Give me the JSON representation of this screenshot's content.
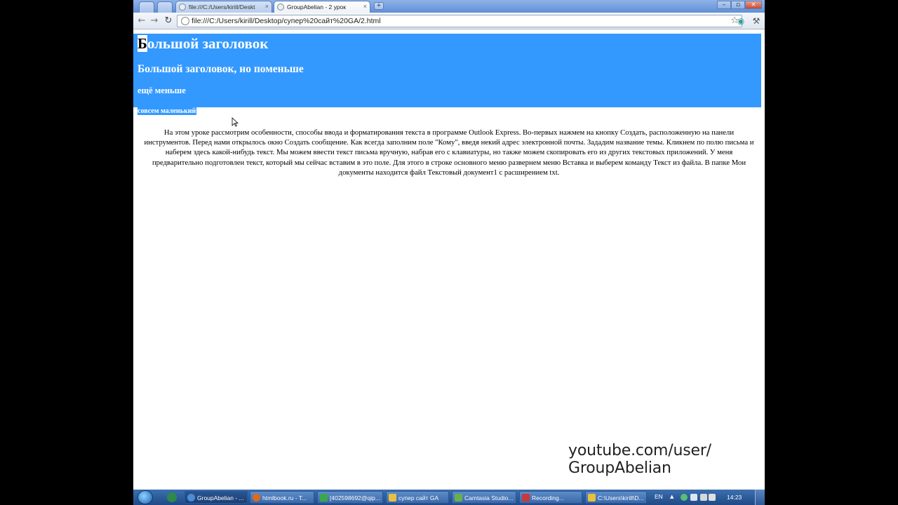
{
  "browser": {
    "tabs": [
      {
        "label": "file:///C:/Users/kirill/Deskt",
        "active": false
      },
      {
        "label": "GroupAbelian - 2 урок",
        "active": true
      }
    ],
    "tab_close": "×",
    "new_tab": "+",
    "window_controls": [
      "–",
      "▫",
      "×"
    ],
    "address": "file:///C:/Users/kirill/Desktop/супер%20сайт%20GA/2.html"
  },
  "page": {
    "h1_first": "Б",
    "h1_rest": "ольшой заголовок",
    "h2": "Большой заголовок, но поменьше",
    "h3": "ещё меньше",
    "h4": "совсем маленький",
    "paragraph": "На этом уроке рассмотрим особенности, способы ввода и форматирования текста в программе Outlook Express. Во-первых нажмем на кнопку Создать, расположенную на панели инструментов. Перед нами открылось окно Создать сообщение. Как всегда заполним поле \"Кому\", введя некий адрес электронной почты. Зададим название темы. Кликнем по полю письма и наберем здесь какой-нибудь текст. Мы можем ввести текст письма вручную, набрав его с клавиатуры, но также можем скопировать его из других текстовых приложений. У меня предварительно подготовлен текст, который мы сейчас вставим в это поле. Для этого в строке основного меню развернем меню Вставка и выберем команду Текст из файла. В папке Мои документы находится файл Текстовый документ1 с расширением txt."
  },
  "watermark": {
    "line1": "youtube.com/user/",
    "line2": "GroupAbelian"
  },
  "taskbar": {
    "tasks": [
      {
        "label": "GroupAbelian - ...",
        "active": true
      },
      {
        "label": "htmlbook.ru - T...",
        "active": false
      },
      {
        "label": "[402598692@qip...",
        "active": false
      },
      {
        "label": "супер сайт GA",
        "active": false
      },
      {
        "label": "Camtasia Studio...",
        "active": false
      },
      {
        "label": "Recording...",
        "active": false
      },
      {
        "label": "C:\\Users\\kirill\\D...",
        "active": false
      }
    ],
    "language": "EN",
    "clock": "14:23"
  },
  "colors": {
    "banner": "#3399ff",
    "heading_text": "#ffffff"
  }
}
